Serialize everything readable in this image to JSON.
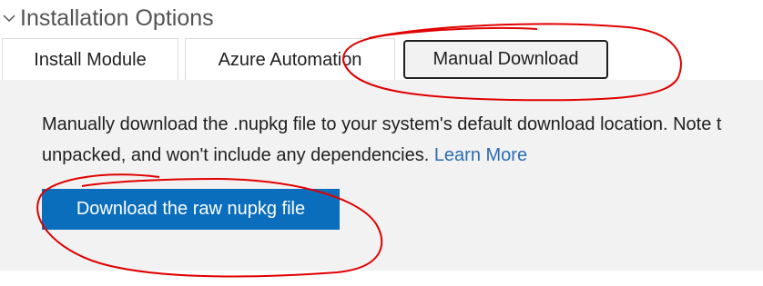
{
  "section": {
    "title": "Installation Options"
  },
  "tabs": [
    {
      "label": "Install Module",
      "active": false
    },
    {
      "label": "Azure Automation",
      "active": false
    },
    {
      "label": "Manual Download",
      "active": true
    }
  ],
  "panel": {
    "description_line1": "Manually download the .nupkg file to your system's default download location. Note t",
    "description_line2": "unpacked, and won't include any dependencies.",
    "learn_more": "Learn More",
    "download_button": "Download the raw nupkg file"
  },
  "icons": {
    "section_chevron": "chevron-down-icon"
  },
  "colors": {
    "button_bg": "#0a6ebd",
    "panel_bg": "#f2f2f2",
    "link": "#2b6cb0",
    "annotation": "#e00000"
  }
}
